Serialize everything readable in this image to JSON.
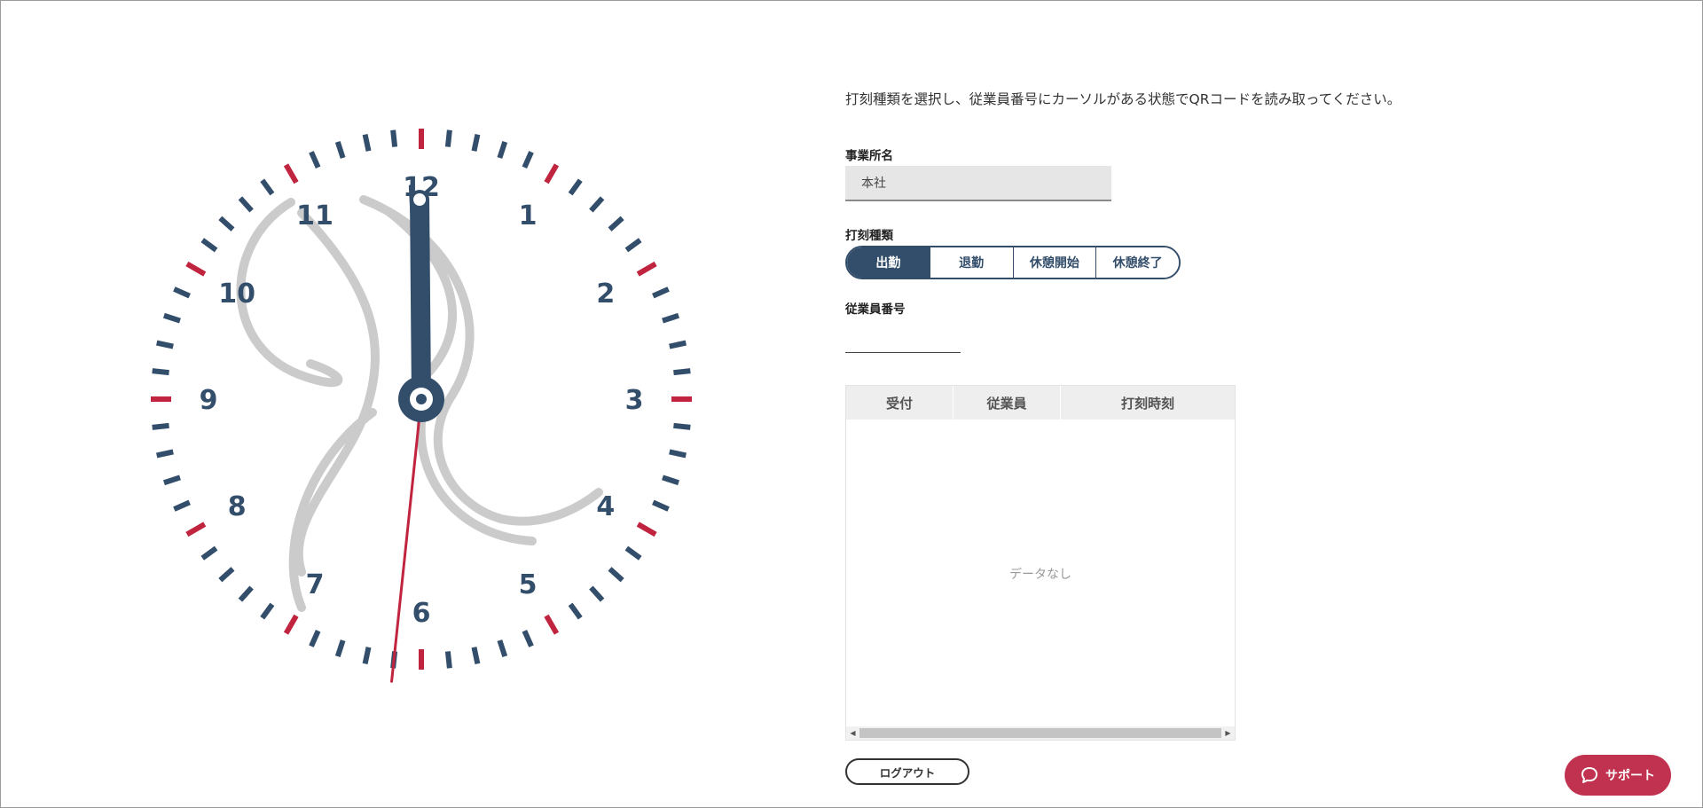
{
  "clock": {
    "numerals": [
      "12",
      "1",
      "2",
      "3",
      "4",
      "5",
      "6",
      "7",
      "8",
      "9",
      "10",
      "11"
    ],
    "time": {
      "hour": 11,
      "minute": 59,
      "second": 31
    },
    "colors": {
      "navy": "#334e6b",
      "red": "#c0243f",
      "watermark": "#cbcbcb"
    }
  },
  "instruction": "打刻種類を選択し、従業員番号にカーソルがある状態でQRコードを読み取ってください。",
  "office": {
    "label": "事業所名",
    "value": "本社"
  },
  "punch": {
    "label": "打刻種類",
    "options": [
      "出勤",
      "退勤",
      "休憩開始",
      "休憩終了"
    ],
    "selected": "出勤"
  },
  "employee": {
    "label": "従業員番号",
    "value": ""
  },
  "table": {
    "columns": [
      "受付",
      "従業員",
      "打刻時刻"
    ],
    "empty_text": "データなし"
  },
  "logout_label": "ログアウト",
  "support": {
    "label": "サポート",
    "icon": "chat-bubble-icon",
    "color": "#c0324f"
  }
}
